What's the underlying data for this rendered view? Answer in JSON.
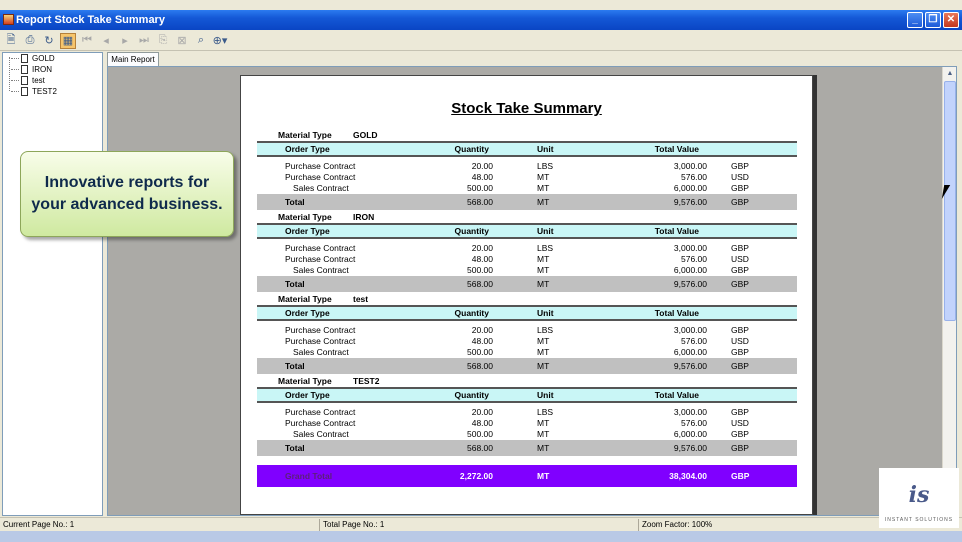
{
  "window": {
    "title": "Report Stock Take Summary",
    "buttons": [
      "_",
      "❐",
      "✕"
    ]
  },
  "toolbar": {
    "icons": [
      "export-icon",
      "print-icon",
      "refresh-icon",
      "toggle-tree-icon",
      "first-page-icon",
      "prev-page-icon",
      "next-page-icon",
      "last-page-icon",
      "goto-page-icon",
      "stop-icon",
      "search-icon",
      "zoom-icon"
    ]
  },
  "tree": {
    "items": [
      "GOLD",
      "IRON",
      "test",
      "TEST2"
    ]
  },
  "tabs": {
    "main": "Main Report"
  },
  "report": {
    "title": "Stock Take Summary",
    "material_type_label": "Material Type",
    "headers": {
      "type": "Order Type",
      "qty": "Quantity",
      "unit": "Unit",
      "value": "Total Value"
    },
    "total_label": "Total",
    "groups": [
      {
        "material": "GOLD",
        "rows": [
          {
            "type": "Purchase Contract",
            "qty": "20.00",
            "unit": "LBS",
            "value": "3,000.00",
            "cur": "GBP"
          },
          {
            "type": "Purchase Contract",
            "qty": "48.00",
            "unit": "MT",
            "value": "576.00",
            "cur": "USD"
          },
          {
            "type": "Sales Contract",
            "qty": "500.00",
            "unit": "MT",
            "value": "6,000.00",
            "cur": "GBP"
          }
        ],
        "total": {
          "qty": "568.00",
          "unit": "MT",
          "value": "9,576.00",
          "cur": "GBP"
        }
      },
      {
        "material": "IRON",
        "rows": [
          {
            "type": "Purchase Contract",
            "qty": "20.00",
            "unit": "LBS",
            "value": "3,000.00",
            "cur": "GBP"
          },
          {
            "type": "Purchase Contract",
            "qty": "48.00",
            "unit": "MT",
            "value": "576.00",
            "cur": "USD"
          },
          {
            "type": "Sales Contract",
            "qty": "500.00",
            "unit": "MT",
            "value": "6,000.00",
            "cur": "GBP"
          }
        ],
        "total": {
          "qty": "568.00",
          "unit": "MT",
          "value": "9,576.00",
          "cur": "GBP"
        }
      },
      {
        "material": "test",
        "rows": [
          {
            "type": "Purchase Contract",
            "qty": "20.00",
            "unit": "LBS",
            "value": "3,000.00",
            "cur": "GBP"
          },
          {
            "type": "Purchase Contract",
            "qty": "48.00",
            "unit": "MT",
            "value": "576.00",
            "cur": "USD"
          },
          {
            "type": "Sales Contract",
            "qty": "500.00",
            "unit": "MT",
            "value": "6,000.00",
            "cur": "GBP"
          }
        ],
        "total": {
          "qty": "568.00",
          "unit": "MT",
          "value": "9,576.00",
          "cur": "GBP"
        }
      },
      {
        "material": "TEST2",
        "rows": [
          {
            "type": "Purchase Contract",
            "qty": "20.00",
            "unit": "LBS",
            "value": "3,000.00",
            "cur": "GBP"
          },
          {
            "type": "Purchase Contract",
            "qty": "48.00",
            "unit": "MT",
            "value": "576.00",
            "cur": "USD"
          },
          {
            "type": "Sales Contract",
            "qty": "500.00",
            "unit": "MT",
            "value": "6,000.00",
            "cur": "GBP"
          }
        ],
        "total": {
          "qty": "568.00",
          "unit": "MT",
          "value": "9,576.00",
          "cur": "GBP"
        }
      }
    ],
    "grand_total": {
      "label": "Grand Total",
      "qty": "2,272.00",
      "unit": "MT",
      "value": "38,304.00",
      "cur": "GBP"
    }
  },
  "callout": {
    "line1": "Innovative reports for",
    "line2": "your advanced business."
  },
  "status": {
    "current_page": "Current Page No.: 1",
    "total_page": "Total Page No.: 1",
    "zoom": "Zoom Factor: 100%"
  },
  "logo": {
    "mark": "i",
    "mark2": "s",
    "text": "INSTANT SOLUTIONS"
  },
  "colors": {
    "header_band": "#c9f6f6",
    "total_band": "#c0c0c0",
    "grand_total_band": "#8000ff",
    "title_bar": "#0a45c4"
  }
}
